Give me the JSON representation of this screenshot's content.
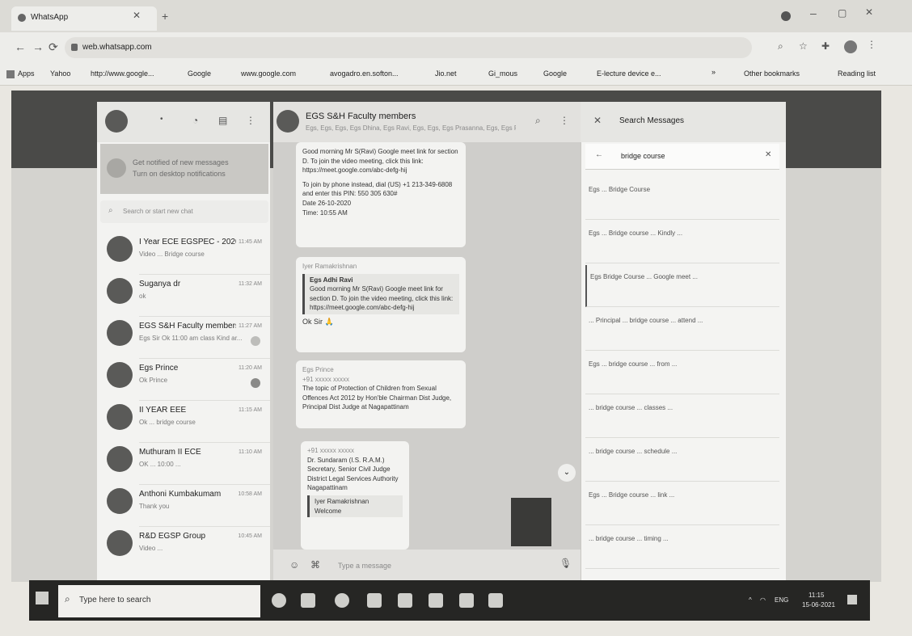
{
  "browser": {
    "tab_title": "WhatsApp",
    "url": "web.whatsapp.com",
    "bookmarks": [
      "Apps",
      "Yahoo",
      "http://www.google...",
      "Google",
      "www.google.com",
      "avogadro.en.softon...",
      "Jio.net",
      "Gi_mous",
      "Google",
      "E-lecture device e..."
    ],
    "other_bookmarks": "Other bookmarks",
    "reading_list": "Reading list"
  },
  "notification": {
    "title": "Get notified of new messages",
    "subtitle": "Turn on desktop notifications"
  },
  "search": {
    "placeholder": "Search or start new chat"
  },
  "chats": [
    {
      "name": "I Year ECE EGSPEC - 2020",
      "preview": "Video ... Bridge course",
      "time": "11:45 AM"
    },
    {
      "name": "Suganya dr",
      "preview": "ok",
      "time": "11:32 AM"
    },
    {
      "name": "EGS S&H Faculty members",
      "preview": "Egs Sir Ok 11:00 am class Kind ar...",
      "time": "11:27 AM"
    },
    {
      "name": "Egs Prince",
      "preview": "Ok Prince",
      "time": "11:20 AM"
    },
    {
      "name": "II YEAR EEE",
      "preview": "Ok ... bridge course",
      "time": "11:15 AM"
    },
    {
      "name": "Muthuram II ECE",
      "preview": "OK ... 10:00 ...",
      "time": "11:10 AM"
    },
    {
      "name": "Anthoni Kumbakumam",
      "preview": "Thank you",
      "time": "10:58 AM"
    },
    {
      "name": "R&D EGSP Group",
      "preview": "Video ...",
      "time": "10:45 AM"
    }
  ],
  "group": {
    "title": "EGS S&H Faculty members",
    "subtitle": "Egs, Egs, Egs, Egs Dhina, Egs Ravi, Egs, Egs, Egs Prasanna, Egs, Egs Prince..."
  },
  "messages": [
    {
      "text1": "Good morning Mr S(Ravi) Google meet link for section D. To join the video meeting, click this link: https://meet.google.com/abc-defg-hij",
      "text2": "To join by phone instead, dial (US) +1 213-349-6808 and enter this PIN: 550 305 630#",
      "date": "Date 26-10-2020",
      "time": "Time: 10:55 AM"
    },
    {
      "sender": "Iyer Ramakrishnan",
      "quote_author": "Egs Adhi Ravi",
      "quote_text": "Good morning Mr S(Ravi) Google meet link for section D. To join the video meeting, click this link: https://meet.google.com/abc-defg-hij",
      "reply": "Ok Sir 🙏"
    },
    {
      "sender": "Egs Prince",
      "phone": "+91 xxxxx xxxxx",
      "text": "The topic of Protection of Children from Sexual Offences Act 2012 by Hon'ble Chairman Dist Judge, Principal Dist Judge at Nagapattinam"
    },
    {
      "phone": "+91 xxxxx xxxxx",
      "lines": [
        "Dr. Sundaram (I.S. R.A.M.)",
        "Secretary, Senior Civil Judge",
        "District Legal Services Authority",
        "Nagapattinam"
      ],
      "quote_author": "Iyer Ramakrishnan",
      "quote_text": "Welcome"
    }
  ],
  "composer": {
    "placeholder": "Type a message"
  },
  "search_panel": {
    "title": "Search Messages",
    "query": "bridge course",
    "results": [
      {
        "date": "",
        "text": "Egs ... Bridge Course"
      },
      {
        "date": "",
        "text": "Egs ... Bridge course ... Kindly ..."
      },
      {
        "date": "",
        "text": "Egs Bridge Course ... Google meet ..."
      },
      {
        "date": "",
        "text": "... Principal ... bridge course ... attend ..."
      },
      {
        "date": "",
        "text": "Egs ... bridge course ... from ..."
      },
      {
        "date": "",
        "text": "... bridge course ... classes ..."
      },
      {
        "date": "",
        "text": "... bridge course ... schedule ..."
      },
      {
        "date": "",
        "text": "Egs ... Bridge course ... link ..."
      },
      {
        "date": "",
        "text": "... bridge course ... timing ..."
      }
    ]
  },
  "taskbar": {
    "search_placeholder": "Type here to search",
    "time": "11:15",
    "date": "15-06-2021",
    "lang": "ENG"
  }
}
